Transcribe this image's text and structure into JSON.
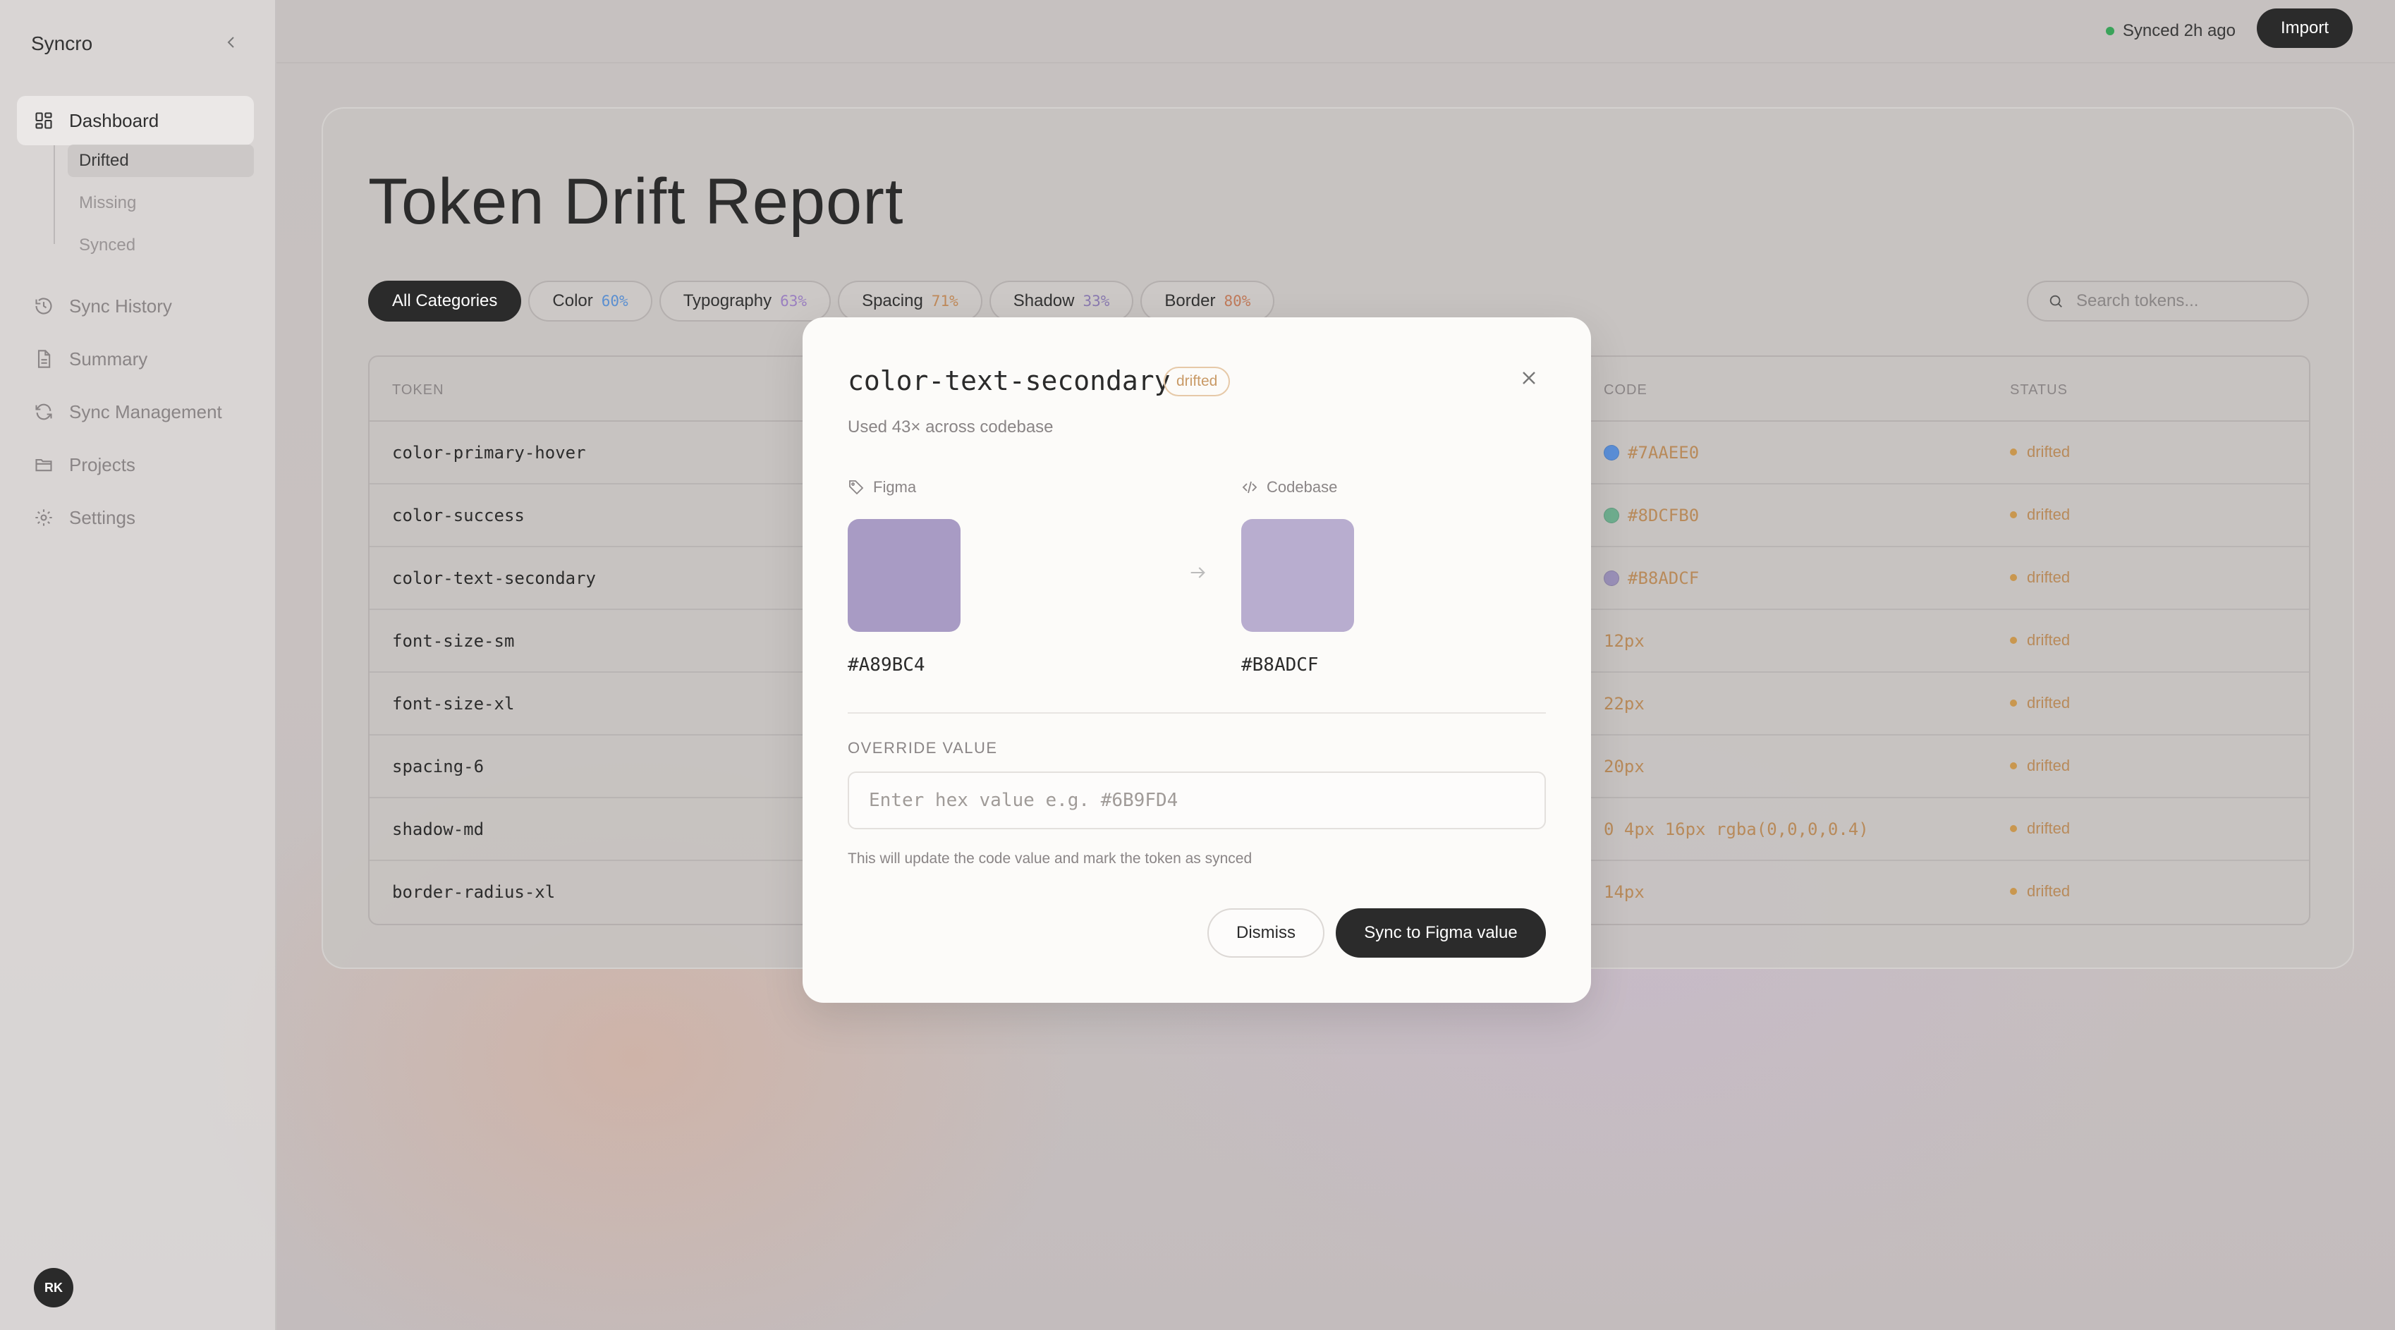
{
  "app": {
    "name": "Syncro"
  },
  "sidebar": {
    "items": [
      {
        "label": "Dashboard",
        "icon": "grid-icon",
        "active": true
      },
      {
        "label": "Sync History",
        "icon": "history-icon"
      },
      {
        "label": "Summary",
        "icon": "document-icon"
      },
      {
        "label": "Sync Management",
        "icon": "refresh-icon"
      },
      {
        "label": "Projects",
        "icon": "folder-icon"
      },
      {
        "label": "Settings",
        "icon": "gear-icon"
      }
    ],
    "sub_items": [
      {
        "label": "Drifted",
        "active": true
      },
      {
        "label": "Missing"
      },
      {
        "label": "Synced"
      }
    ],
    "avatar_initials": "RK"
  },
  "topbar": {
    "sync_status": "Synced 2h ago",
    "import_label": "Import"
  },
  "main": {
    "title": "Token Drift Report",
    "chips": [
      {
        "label": "All Categories",
        "pct": "",
        "active": true
      },
      {
        "label": "Color",
        "pct": "60%",
        "pct_color": "#5b8fd0"
      },
      {
        "label": "Typography",
        "pct": "63%",
        "pct_color": "#9a7fc0"
      },
      {
        "label": "Spacing",
        "pct": "71%",
        "pct_color": "#c08a5a"
      },
      {
        "label": "Shadow",
        "pct": "33%",
        "pct_color": "#8a7ab0"
      },
      {
        "label": "Border",
        "pct": "80%",
        "pct_color": "#c07a5a"
      }
    ],
    "search_placeholder": "Search tokens...",
    "table": {
      "headers": {
        "token": "TOKEN",
        "code": "CODE",
        "status": "STATUS"
      },
      "rows": [
        {
          "token": "color-primary-hover",
          "code": "#7AAEE0",
          "swatch": "#5b8fd8",
          "status": "drifted"
        },
        {
          "token": "color-success",
          "code": "#8DCFB0",
          "swatch": "#6fae8f",
          "status": "drifted"
        },
        {
          "token": "color-text-secondary",
          "code": "#B8ADCF",
          "swatch": "#9a90b8",
          "status": "drifted"
        },
        {
          "token": "font-size-sm",
          "code": "12px",
          "swatch": "",
          "status": "drifted"
        },
        {
          "token": "font-size-xl",
          "code": "22px",
          "swatch": "",
          "status": "drifted"
        },
        {
          "token": "spacing-6",
          "code": "20px",
          "swatch": "",
          "status": "drifted"
        },
        {
          "token": "shadow-md",
          "code": "0 4px 16px rgba(0,0,0,0.4)",
          "swatch": "",
          "status": "drifted"
        },
        {
          "token": "border-radius-xl",
          "code": "14px",
          "swatch": "",
          "status": "drifted"
        }
      ]
    }
  },
  "modal": {
    "title": "color-text-secondary",
    "badge": "drifted",
    "usage": "Used 43× across codebase",
    "figma_label": "Figma",
    "codebase_label": "Codebase",
    "figma_hex": "#A89BC4",
    "codebase_hex": "#B8ADCF",
    "override_label": "OVERRIDE VALUE",
    "override_placeholder": "Enter hex value e.g. #6B9FD4",
    "override_value": "",
    "help_text": "This will update the code value and mark the token as synced",
    "dismiss_label": "Dismiss",
    "sync_label": "Sync to Figma value"
  }
}
